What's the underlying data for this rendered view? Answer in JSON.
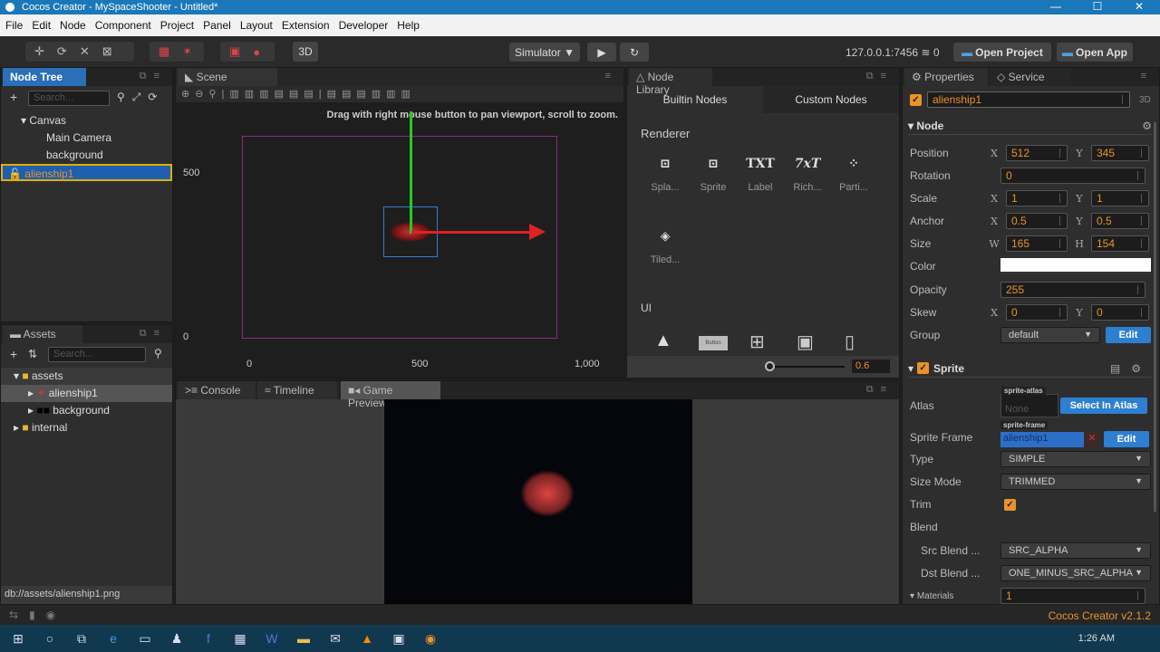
{
  "window": {
    "title": "Cocos Creator - MySpaceShooter - Untitled*",
    "controls": [
      "—",
      "☐",
      "✕"
    ]
  },
  "menu": [
    "File",
    "Edit",
    "Node",
    "Component",
    "Project",
    "Panel",
    "Layout",
    "Extension",
    "Developer",
    "Help"
  ],
  "toolbar": {
    "btn_3d": "3D",
    "simulator": "Simulator ▼",
    "play": "▶",
    "refresh": "↻",
    "server": "127.0.0.1:7456",
    "wifi_count": "0",
    "open_project": "Open Project",
    "open_app": "Open App"
  },
  "node_tree": {
    "title": "Node Tree",
    "search_placeholder": "Search...",
    "items": [
      {
        "label": "Canvas",
        "depth": 0
      },
      {
        "label": "Main Camera",
        "depth": 1
      },
      {
        "label": "background",
        "depth": 1
      },
      {
        "label": "alienship1",
        "depth": 0,
        "selected": true
      }
    ]
  },
  "scene": {
    "title": "Scene",
    "hint": "Drag with right mouse button to pan viewport, scroll to zoom.",
    "y_ticks": [
      "500",
      "0"
    ],
    "x_ticks": [
      "0",
      "500",
      "1,000"
    ]
  },
  "node_library": {
    "title": "Node Library",
    "tabs": [
      "Builtin Nodes",
      "Custom Nodes"
    ],
    "section_renderer": "Renderer",
    "renderer_items": [
      {
        "icon": "⊡",
        "label": "Spla..."
      },
      {
        "icon": "⊡",
        "label": "Sprite"
      },
      {
        "icon": "TXT",
        "label": "Label"
      },
      {
        "icon": "7xT",
        "label": "Rich..."
      },
      {
        "icon": "⁘",
        "label": "Parti..."
      },
      {
        "icon": "◈",
        "label": "Tiled..."
      }
    ],
    "section_ui": "UI",
    "ui_button_text": "Button",
    "zoom_value": "0.6",
    "zoom_fraction": 0.6
  },
  "assets": {
    "title": "Assets",
    "search_placeholder": "Search...",
    "items": [
      {
        "label": "assets",
        "depth": 0
      },
      {
        "label": "alienship1",
        "depth": 1
      },
      {
        "label": "background",
        "depth": 1
      },
      {
        "label": "internal",
        "depth": 0
      }
    ],
    "status_path": "db://assets/alienship1.png"
  },
  "bottom_tabs": [
    "Console",
    "Timeline",
    "Game Preview"
  ],
  "properties": {
    "tabs": [
      "Properties",
      "Service"
    ],
    "node_name": "alienship1",
    "badge_3d": "3D",
    "node_section": "Node",
    "position": {
      "label": "Position",
      "x": "512",
      "y": "345"
    },
    "rotation": {
      "label": "Rotation",
      "value": "0"
    },
    "scale": {
      "label": "Scale",
      "x": "1",
      "y": "1"
    },
    "anchor": {
      "label": "Anchor",
      "x": "0.5",
      "y": "0.5"
    },
    "size": {
      "label": "Size",
      "w": "165",
      "h": "154"
    },
    "color": {
      "label": "Color",
      "value": "#ffffff"
    },
    "opacity": {
      "label": "Opacity",
      "value": "255"
    },
    "skew": {
      "label": "Skew",
      "x": "0",
      "y": "0"
    },
    "group": {
      "label": "Group",
      "value": "default",
      "edit": "Edit"
    },
    "sprite_section": "Sprite",
    "atlas": {
      "label": "Atlas",
      "tag": "sprite-atlas",
      "value": "None",
      "button": "Select In Atlas"
    },
    "sprite_frame": {
      "label": "Sprite Frame",
      "tag": "sprite-frame",
      "value": "alienship1",
      "edit": "Edit"
    },
    "type": {
      "label": "Type",
      "value": "SIMPLE"
    },
    "size_mode": {
      "label": "Size Mode",
      "value": "TRIMMED"
    },
    "trim": {
      "label": "Trim",
      "checked": true
    },
    "blend": "Blend",
    "src_blend": {
      "label": "Src Blend ...",
      "value": "SRC_ALPHA"
    },
    "dst_blend": {
      "label": "Dst Blend ...",
      "value": "ONE_MINUS_SRC_ALPHA"
    },
    "materials": {
      "label": "Materials",
      "value": "1"
    },
    "axis": {
      "x": "X",
      "y": "Y",
      "w": "W",
      "h": "H"
    }
  },
  "status": {
    "version": "Cocos Creator v2.1.2"
  },
  "taskbar": {
    "time": "1:26 AM"
  },
  "colors": {
    "accent": "#2a6fb8",
    "value": "#e8932b",
    "titlebar": "#1b78b8"
  }
}
